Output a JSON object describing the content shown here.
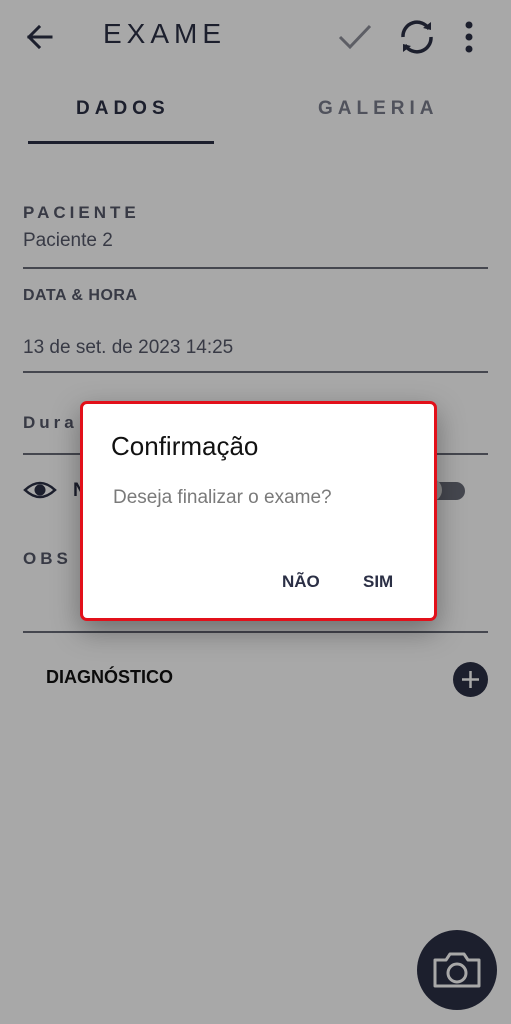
{
  "appbar": {
    "title": "EXAME",
    "icons": [
      "back-arrow-icon",
      "check-icon",
      "sync-icon",
      "more-vert-icon"
    ]
  },
  "tabs": [
    {
      "label": "DADOS",
      "selected": true
    },
    {
      "label": "GALERIA",
      "selected": false
    }
  ],
  "form": {
    "paciente_label": "PACIENTE",
    "paciente_value": "Paciente 2",
    "datahora_label": "DATA & HORA",
    "datahora_value": "13 de set. de 2023 14:25",
    "duracao_label_partial": "Dura",
    "visibility_label_partial": "N",
    "obs_label_partial": "OBS",
    "diagnostico_label": "DIAGNÓSTICO"
  },
  "dialog": {
    "title": "Confirmação",
    "message": "Deseja finalizar o exame?",
    "no_label": "NÃO",
    "yes_label": "SIM"
  },
  "colors": {
    "primary": "#2b2f45",
    "dialog_border": "#e2101a"
  }
}
